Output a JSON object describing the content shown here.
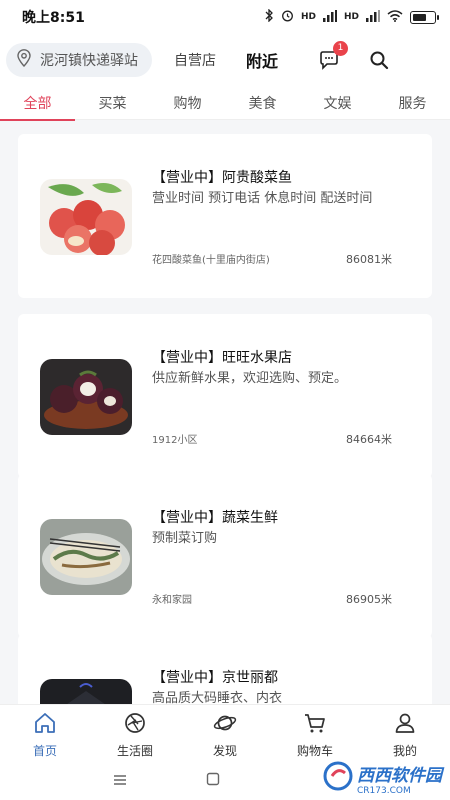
{
  "status_bar": {
    "time": "晚上8:51",
    "signal1": "HD",
    "signal2": "HD"
  },
  "top_bar": {
    "location": "泥河镇快递驿站",
    "self_store": "自营店",
    "nearby": "附近",
    "message_badge": "1"
  },
  "tabs": [
    {
      "label": "全部",
      "active": true
    },
    {
      "label": "买菜",
      "active": false
    },
    {
      "label": "购物",
      "active": false
    },
    {
      "label": "美食",
      "active": false
    },
    {
      "label": "文娱",
      "active": false
    },
    {
      "label": "服务",
      "active": false
    }
  ],
  "shops": [
    {
      "name": "【营业中】阿贵酸菜鱼",
      "desc": "营业时间 预订电话 休息时间 配送时间",
      "addr": "花四酸菜鱼(十里庙内街店)",
      "dist": "86081米",
      "thumb_icon": "apples-image"
    },
    {
      "name": "【营业中】旺旺水果店",
      "desc": "供应新鲜水果，欢迎选购、预定。",
      "addr": "1912小区",
      "dist": "84664米",
      "thumb_icon": "mangosteen-image"
    },
    {
      "name": "【营业中】蔬菜生鲜",
      "desc": "预制菜订购",
      "addr": "永和家园",
      "dist": "86905米",
      "thumb_icon": "dish-image"
    },
    {
      "name": "【营业中】京世丽都",
      "desc": "高品质大码睡衣、内衣",
      "addr": "",
      "dist": "",
      "thumb_icon": "clothing-image"
    }
  ],
  "bottom_nav": [
    {
      "label": "首页",
      "icon": "home-icon",
      "active": true
    },
    {
      "label": "生活圈",
      "icon": "aperture-icon",
      "active": false
    },
    {
      "label": "发现",
      "icon": "planet-icon",
      "active": false
    },
    {
      "label": "购物车",
      "icon": "cart-icon",
      "active": false
    },
    {
      "label": "我的",
      "icon": "user-icon",
      "active": false
    }
  ],
  "watermark": {
    "brand": "西西",
    "brand2": "软件园",
    "site": "CR173.COM"
  },
  "colors": {
    "accent": "#e0435a",
    "nav_active": "#3c6fb8",
    "badge": "#e9434b"
  }
}
